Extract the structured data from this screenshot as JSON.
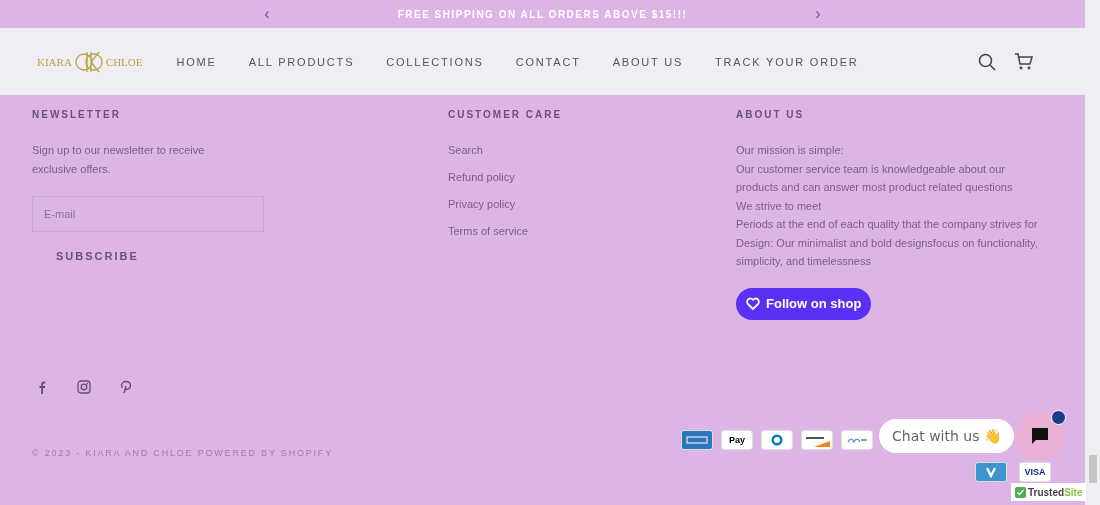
{
  "announcement": {
    "prev": "‹",
    "text": "FREE SHIPPING ON ALL ORDERS ABOVE $15!!!",
    "next": "›"
  },
  "header": {
    "logo": {
      "left": "KIARA",
      "right": "CHLOE"
    },
    "nav": [
      {
        "label": "HOME"
      },
      {
        "label": "ALL PRODUCTS"
      },
      {
        "label": "COLLECTIONS"
      },
      {
        "label": "CONTACT"
      },
      {
        "label": "ABOUT US"
      },
      {
        "label": "TRACK YOUR ORDER"
      }
    ]
  },
  "newsletter": {
    "title": "NEWSLETTER",
    "text": "Sign up to our newsletter to receive exclusive offers.",
    "placeholder": "E-mail",
    "button": "SUBSCRIBE"
  },
  "customer_care": {
    "title": "CUSTOMER CARE",
    "links": [
      "Search",
      "Refund policy",
      "Privacy policy",
      "Terms of service"
    ]
  },
  "about": {
    "title": "ABOUT US",
    "lines": [
      "Our mission is simple:",
      "Our customer service team is knowledgeable about our products and can answer most product related questions",
      "We strive to meet",
      "Periods at the end of each quality that the company strives for",
      "Design: Our minimalist and bold designsfocus on functionality, simplicity, and timelessness"
    ],
    "follow_button": "Follow on shop"
  },
  "social": [
    {
      "kind": "facebook"
    },
    {
      "kind": "instagram"
    },
    {
      "kind": "pinterest"
    }
  ],
  "copyright": "© 2023 - KIARA AND CHLOE POWERED BY SHOPIFY",
  "payments": [
    {
      "kind": "amex"
    },
    {
      "kind": "applepay",
      "label": "Pay"
    },
    {
      "kind": "diners"
    },
    {
      "kind": "discover"
    },
    {
      "kind": "meta"
    },
    {
      "kind": "venmo"
    },
    {
      "kind": "visa",
      "label": "VISA"
    }
  ],
  "chat": {
    "label": "Chat with us 👋"
  },
  "trust_badge": {
    "part_1": "Trusted",
    "part_2": "Site"
  }
}
